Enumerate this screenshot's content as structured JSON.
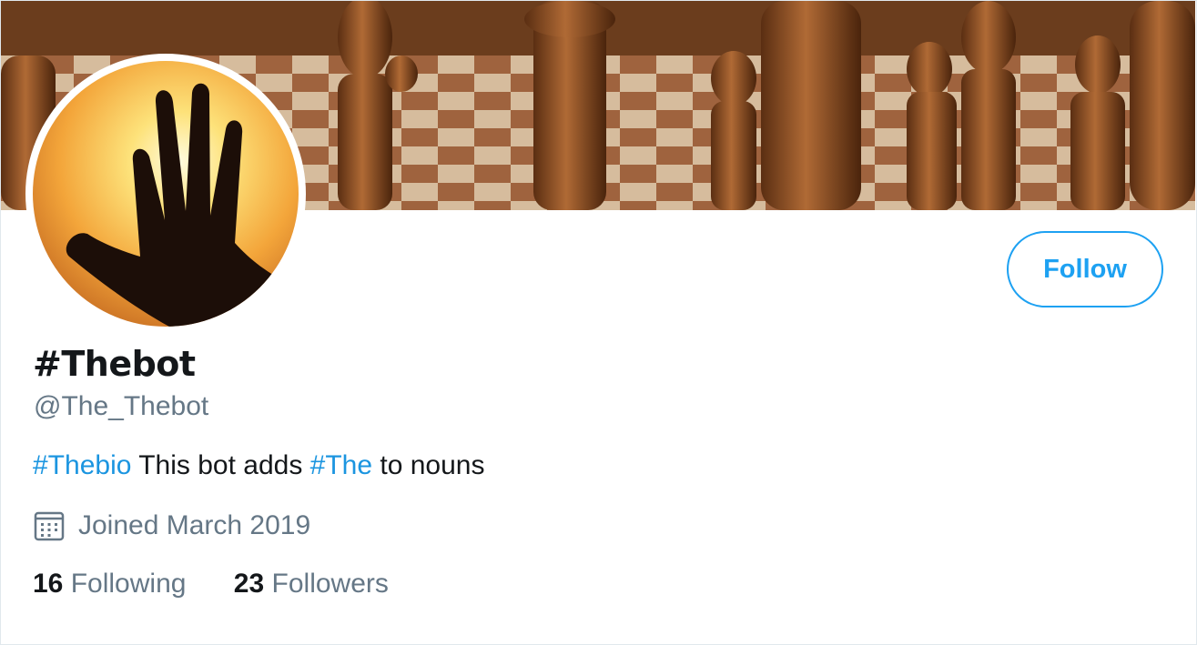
{
  "profile": {
    "display_name": "#Thebot",
    "handle": "@The_Thebot",
    "bio": {
      "tag1": "#Thebio",
      "text1": " This bot adds ",
      "tag2": "#The",
      "text2": " to nouns"
    },
    "joined": "Joined March 2019",
    "following_count": "16",
    "following_label": "Following",
    "followers_count": "23",
    "followers_label": "Followers"
  },
  "actions": {
    "follow_label": "Follow"
  },
  "icons": {
    "joined": "calendar-icon"
  },
  "colors": {
    "accent": "#1da1f2",
    "link": "#1b95e0",
    "text_primary": "#14171a",
    "text_secondary": "#657786"
  }
}
